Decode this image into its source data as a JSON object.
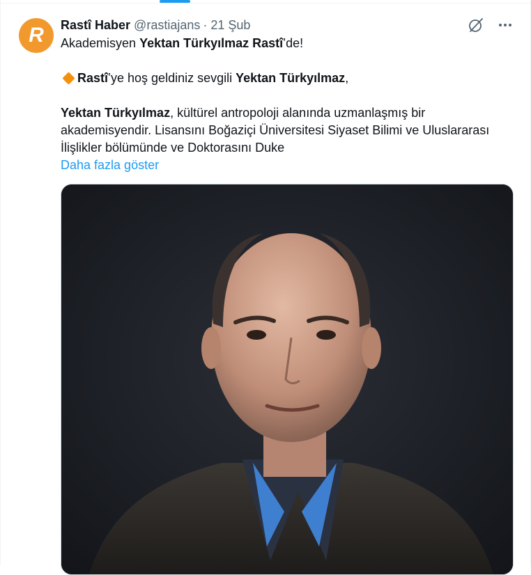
{
  "tweet": {
    "display_name": "Rastî Haber",
    "handle": "@rastiajans",
    "separator": "·",
    "time": "21 Şub",
    "avatar_letter": "R",
    "line1": {
      "prefix": "Akademisyen ",
      "bold": "Yektan Türkyılmaz Rastî",
      "suffix": "’de!"
    },
    "line2": {
      "bold1": "Rastî",
      "middle": "’ye hoş geldiniz sevgili ",
      "bold2": "Yektan Türkyılmaz",
      "suffix": ","
    },
    "line3": {
      "bold": "Yektan Türkyılmaz",
      "rest": ", kültürel antropoloji alanında uzmanlaşmış bir akademisyendir. Lisansını Boğaziçi Üniversitesi Siyaset Bilimi ve Uluslararası İlişlikler bölümünde ve Doktorasını Duke"
    },
    "show_more": "Daha fazla göster"
  },
  "icons": {
    "avatar": "rasti-logo-avatar",
    "grok": "grok-icon",
    "more": "more-icon",
    "emoji": "orange-diamond-emoji"
  },
  "colors": {
    "accent": "#1d9bf0",
    "avatar_bg": "#f2992e",
    "secondary_text": "#536471",
    "diamond": "#f4900c"
  }
}
